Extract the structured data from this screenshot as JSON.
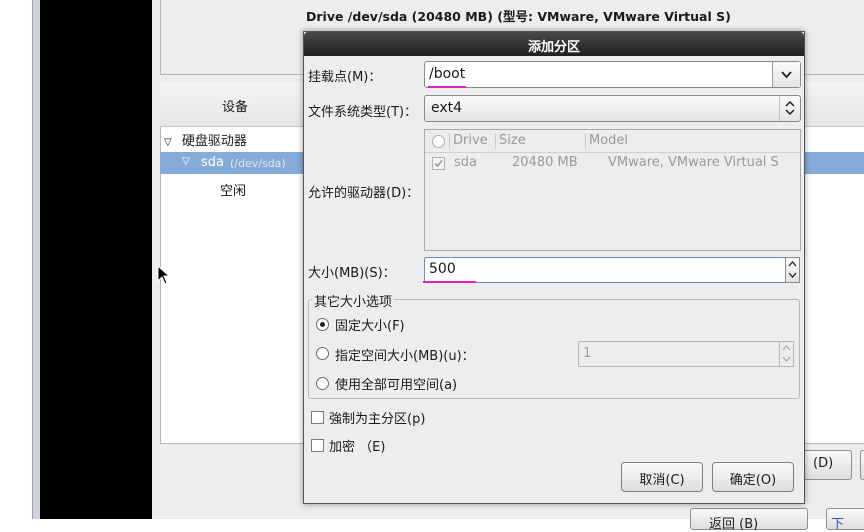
{
  "background": {
    "drive_heading": "Drive /dev/sda (20480 MB) (型号: VMware, VMware Virtual S)",
    "tree": {
      "column_device": "设备",
      "hard_drives_label": "硬盘驱动器",
      "sda_name": "sda",
      "sda_path": "(/dev/sda)",
      "free_label": "空闲"
    },
    "buttons": {
      "delete_partial": "(D)",
      "back": "返回 (B)",
      "next_partial": "下"
    }
  },
  "dialog": {
    "title": "添加分区",
    "mount_point": {
      "label": "挂载点(M)：",
      "value": "/boot"
    },
    "fs_type": {
      "label": "文件系统类型(T)：",
      "value": "ext4"
    },
    "allowed_drives": {
      "label": "允许的驱动器(D)：",
      "columns": [
        "Drive",
        "Size",
        "Model"
      ],
      "rows": [
        {
          "checked": true,
          "drive": "sda",
          "size": "20480 MB",
          "model": "VMware, VMware Virtual S"
        }
      ]
    },
    "size": {
      "label": "大小(MB)(S)：",
      "value": "500"
    },
    "other_size_options": {
      "legend": "其它大小选项",
      "fixed": "固定大小(F)",
      "fill_up_to": "指定空间大小(MB)(u)：",
      "fill_up_to_value": "1",
      "fill_all": "使用全部可用空间(a)",
      "selected": "fixed"
    },
    "force_primary": {
      "label": "強制为主分区(p)",
      "checked": false
    },
    "encrypt": {
      "label": "加密 （E)",
      "checked": false
    },
    "cancel_label": "取消(C)",
    "ok_label": "确定(O)"
  },
  "colors": {
    "selection_row": "#86abd9",
    "title_bar": "#2a2a2a",
    "annotation_underline": "#e020c8"
  }
}
